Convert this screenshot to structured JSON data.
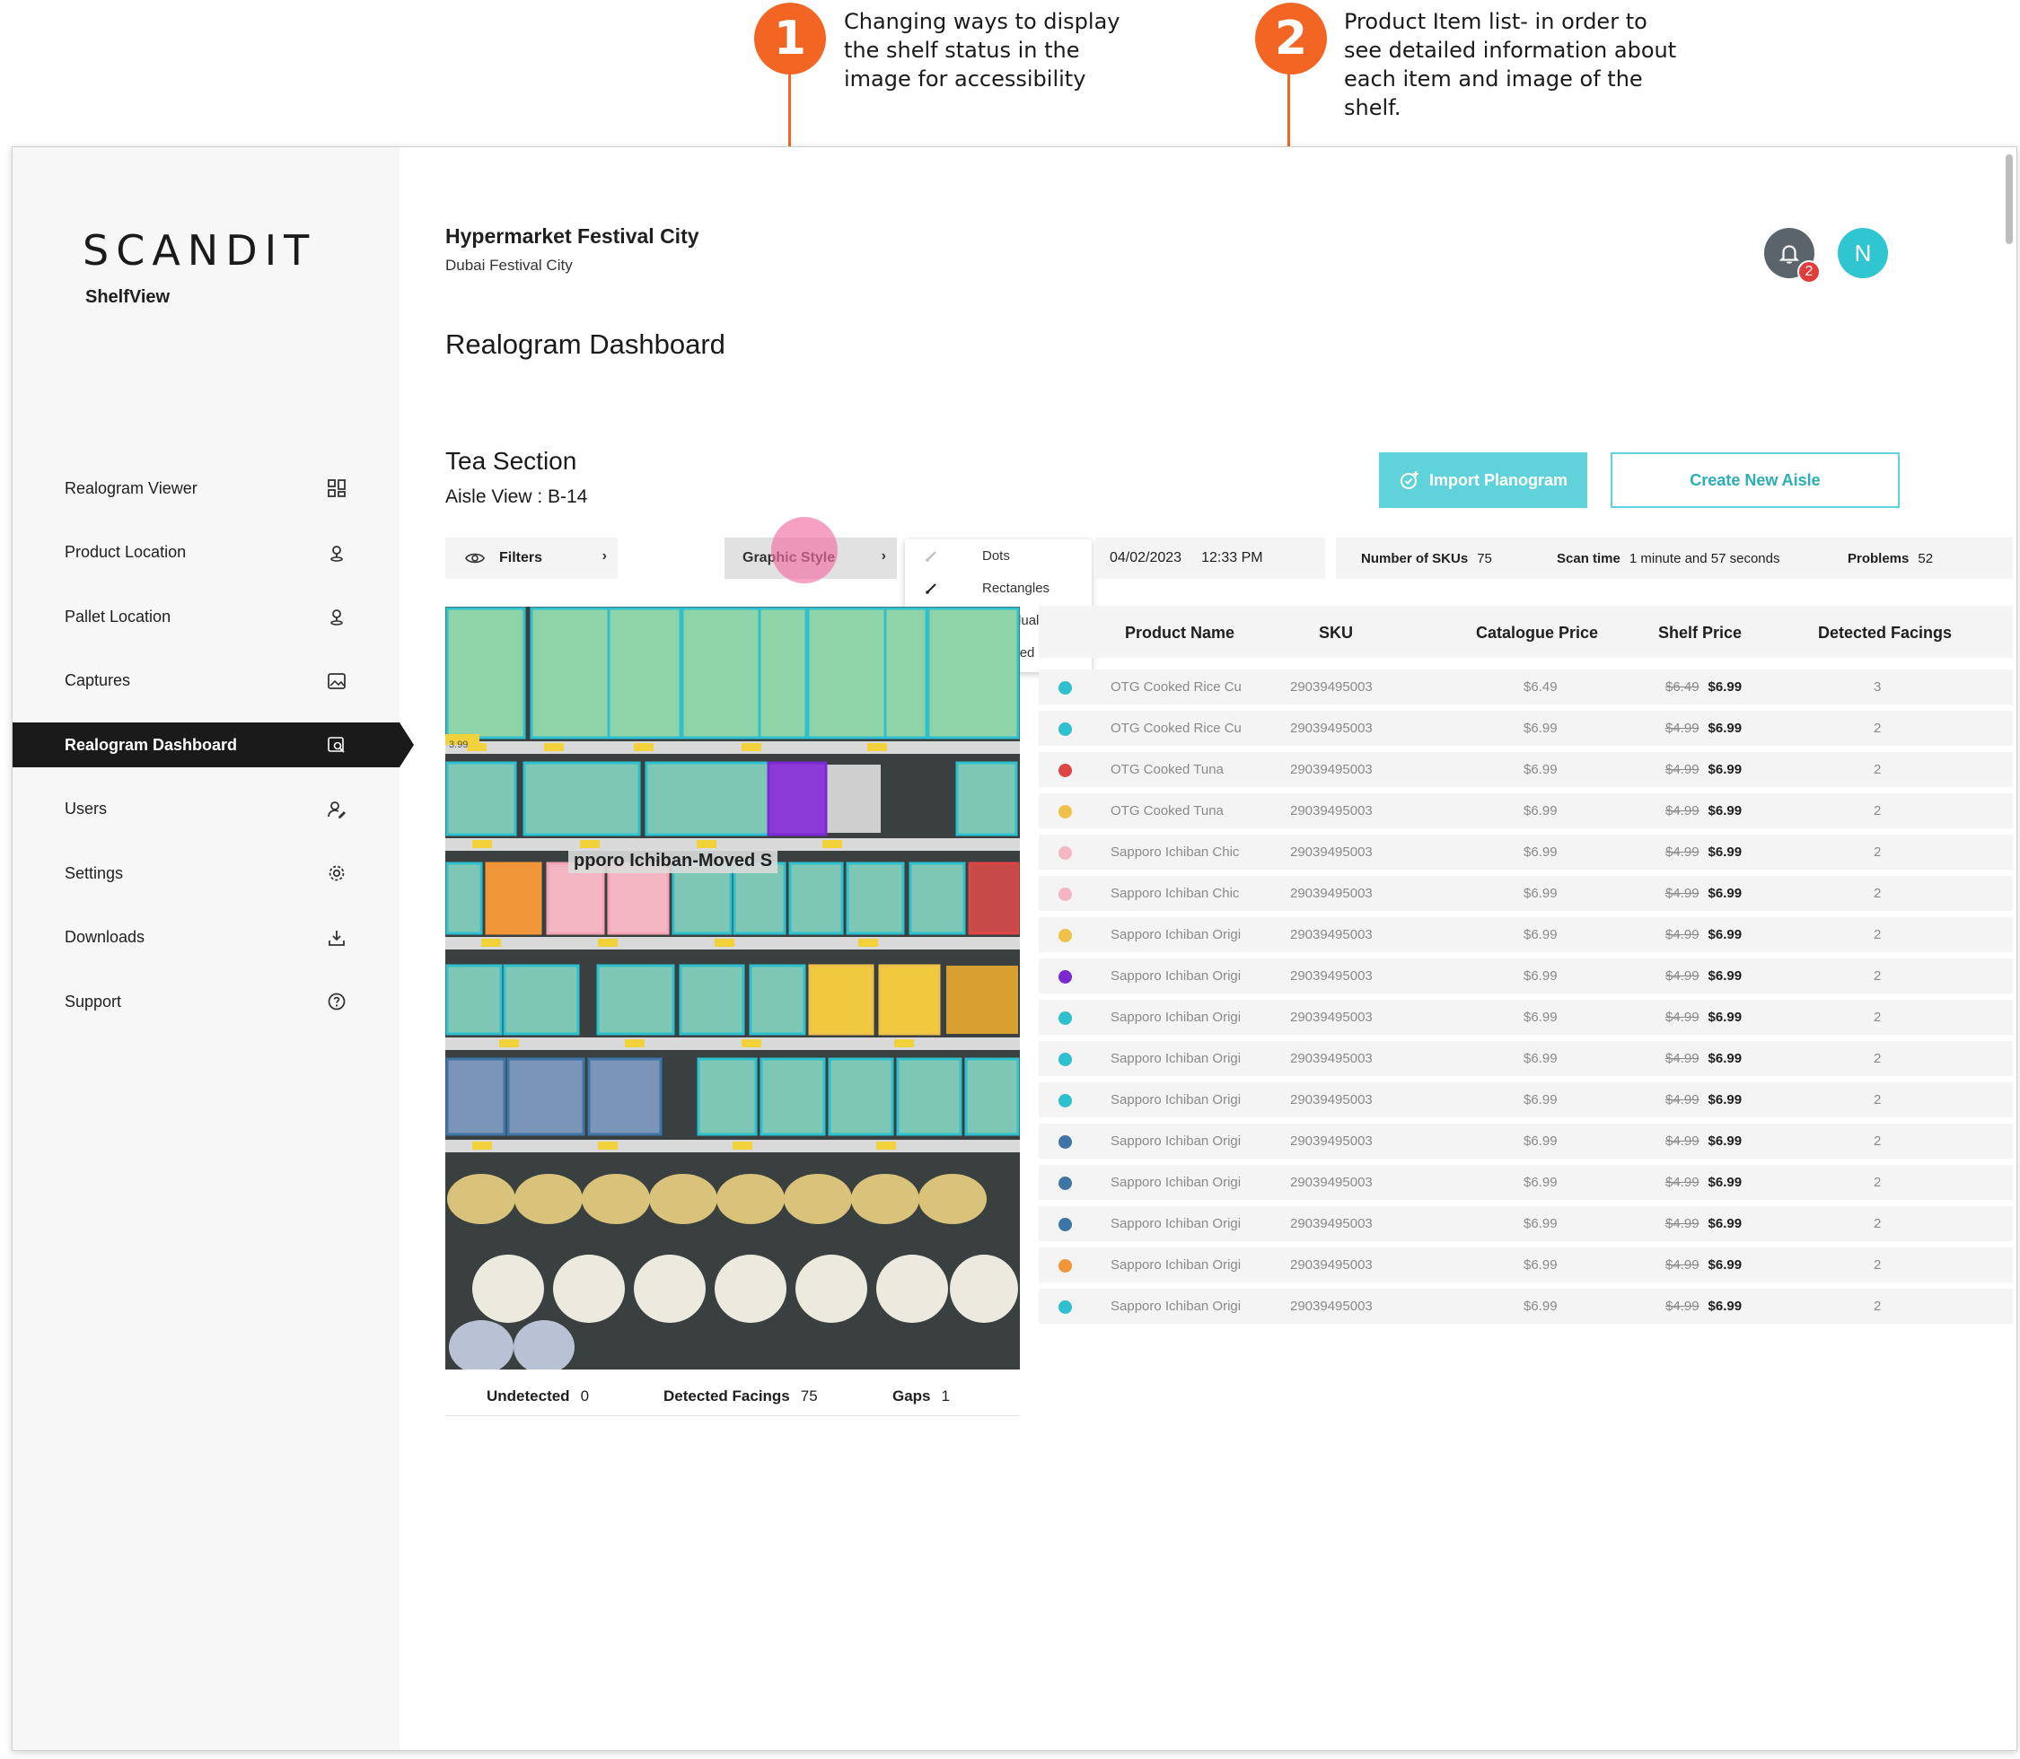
{
  "annotations": [
    {
      "number": "1",
      "text": "Changing ways to display the shelf status in the image for accessibility"
    },
    {
      "number": "2",
      "text": "Product Item list- in order to see detailed information about each item and image of the shelf."
    }
  ],
  "brand": {
    "logo": "SCANDIT",
    "product": "ShelfView"
  },
  "nav": [
    {
      "label": "Realogram Viewer",
      "icon": "grid-icon"
    },
    {
      "label": "Product Location",
      "icon": "location-pin-icon"
    },
    {
      "label": "Pallet Location",
      "icon": "location-pin-icon"
    },
    {
      "label": "Captures",
      "icon": "image-icon"
    },
    {
      "label": "Realogram Dashboard",
      "icon": "search-image-icon",
      "active": true
    },
    {
      "label": "Users",
      "icon": "user-edit-icon"
    },
    {
      "label": "Settings",
      "icon": "gear-icon"
    },
    {
      "label": "Downloads",
      "icon": "download-icon"
    },
    {
      "label": "Support",
      "icon": "help-icon"
    }
  ],
  "header": {
    "store": "Hypermarket Festival City",
    "location": "Dubai Festival City",
    "page_title": "Realogram Dashboard",
    "notifications": "2",
    "avatar_initial": "N"
  },
  "section": {
    "title": "Tea Section",
    "aisle": "Aisle View : B-14"
  },
  "buttons": {
    "import": "Import Planogram",
    "create": "Create New Aisle"
  },
  "toolbar": {
    "filters": "Filters",
    "graphic_style": "Graphic Style",
    "style_options": [
      "Dots",
      "Rectangles",
      "Individual Items",
      "Grouped Items"
    ],
    "date": "04/02/2023",
    "time": "12:33 PM"
  },
  "stats": {
    "skus_label": "Number of SKUs",
    "skus": "75",
    "scan_label": "Scan time",
    "scan": "1 minute and 57 seconds",
    "problems_label": "Problems",
    "problems": "52"
  },
  "shelf": {
    "overlay_label": "pporo Ichiban-Moved S",
    "price_tag": "3.99"
  },
  "counts": {
    "undetected_label": "Undetected",
    "undetected": "0",
    "facings_label": "Detected Facings",
    "facings": "75",
    "gaps_label": "Gaps",
    "gaps": "1"
  },
  "table": {
    "headers": [
      "Product Name",
      "SKU",
      "Catalogue Price",
      "Shelf Price",
      "Detected Facings"
    ],
    "rows": [
      {
        "color": "#2fc0cf",
        "name": "OTG Cooked Rice Cu",
        "sku": "29039495003",
        "catalogue": "$6.49",
        "old": "$6.49",
        "shelf": "$6.99",
        "facings": "3"
      },
      {
        "color": "#2fc0cf",
        "name": "OTG Cooked Rice Cu",
        "sku": "29039495003",
        "catalogue": "$6.99",
        "old": "$4.99",
        "shelf": "$6.99",
        "facings": "2"
      },
      {
        "color": "#e04545",
        "name": "OTG Cooked Tuna",
        "sku": "29039495003",
        "catalogue": "$6.99",
        "old": "$4.99",
        "shelf": "$6.99",
        "facings": "2"
      },
      {
        "color": "#efc14a",
        "name": "OTG Cooked Tuna",
        "sku": "29039495003",
        "catalogue": "$6.99",
        "old": "$4.99",
        "shelf": "$6.99",
        "facings": "2"
      },
      {
        "color": "#f4b6c2",
        "name": "Sapporo Ichiban Chic",
        "sku": "29039495003",
        "catalogue": "$6.99",
        "old": "$4.99",
        "shelf": "$6.99",
        "facings": "2"
      },
      {
        "color": "#f4b6c2",
        "name": "Sapporo Ichiban Chic",
        "sku": "29039495003",
        "catalogue": "$6.99",
        "old": "$4.99",
        "shelf": "$6.99",
        "facings": "2"
      },
      {
        "color": "#efc14a",
        "name": "Sapporo Ichiban Origi",
        "sku": "29039495003",
        "catalogue": "$6.99",
        "old": "$4.99",
        "shelf": "$6.99",
        "facings": "2"
      },
      {
        "color": "#7a2ad0",
        "name": "Sapporo Ichiban Origi",
        "sku": "29039495003",
        "catalogue": "$6.99",
        "old": "$4.99",
        "shelf": "$6.99",
        "facings": "2"
      },
      {
        "color": "#2fc0cf",
        "name": "Sapporo Ichiban Origi",
        "sku": "29039495003",
        "catalogue": "$6.99",
        "old": "$4.99",
        "shelf": "$6.99",
        "facings": "2"
      },
      {
        "color": "#2fc0cf",
        "name": "Sapporo Ichiban Origi",
        "sku": "29039495003",
        "catalogue": "$6.99",
        "old": "$4.99",
        "shelf": "$6.99",
        "facings": "2"
      },
      {
        "color": "#2fc0cf",
        "name": "Sapporo Ichiban Origi",
        "sku": "29039495003",
        "catalogue": "$6.99",
        "old": "$4.99",
        "shelf": "$6.99",
        "facings": "2"
      },
      {
        "color": "#3f74a6",
        "name": "Sapporo Ichiban Origi",
        "sku": "29039495003",
        "catalogue": "$6.99",
        "old": "$4.99",
        "shelf": "$6.99",
        "facings": "2"
      },
      {
        "color": "#3f74a6",
        "name": "Sapporo Ichiban Origi",
        "sku": "29039495003",
        "catalogue": "$6.99",
        "old": "$4.99",
        "shelf": "$6.99",
        "facings": "2"
      },
      {
        "color": "#3f74a6",
        "name": "Sapporo Ichiban Origi",
        "sku": "29039495003",
        "catalogue": "$6.99",
        "old": "$4.99",
        "shelf": "$6.99",
        "facings": "2"
      },
      {
        "color": "#f2963a",
        "name": "Sapporo Ichiban Origi",
        "sku": "29039495003",
        "catalogue": "$6.99",
        "old": "$4.99",
        "shelf": "$6.99",
        "facings": "2"
      },
      {
        "color": "#2fc0cf",
        "name": "Sapporo Ichiban Origi",
        "sku": "29039495003",
        "catalogue": "$6.99",
        "old": "$4.99",
        "shelf": "$6.99",
        "facings": "2"
      }
    ]
  }
}
